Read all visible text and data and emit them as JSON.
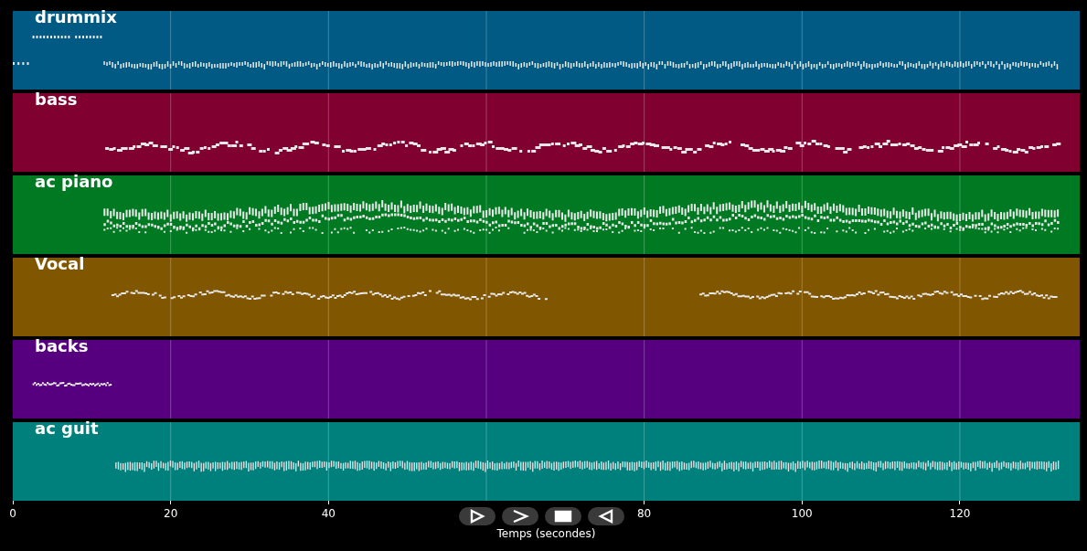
{
  "tracks": [
    {
      "name": "drummix",
      "color": "#005a84",
      "kind": "drums"
    },
    {
      "name": "bass",
      "color": "#800030",
      "kind": "bass"
    },
    {
      "name": "ac piano",
      "color": "#007a22",
      "kind": "piano"
    },
    {
      "name": "Vocal",
      "color": "#805600",
      "kind": "vocal"
    },
    {
      "name": "backs",
      "color": "#560080",
      "kind": "backs"
    },
    {
      "name": "ac guit",
      "color": "#00807c",
      "kind": "guitar"
    }
  ],
  "axis": {
    "xticks": [
      "0",
      "20",
      "40",
      "80",
      "100",
      "120"
    ],
    "xlabel": "Temps (secondes)"
  },
  "controls": [
    {
      "kind": "skip-forward"
    },
    {
      "kind": "forward"
    },
    {
      "kind": "stop"
    },
    {
      "kind": "back"
    }
  ]
}
